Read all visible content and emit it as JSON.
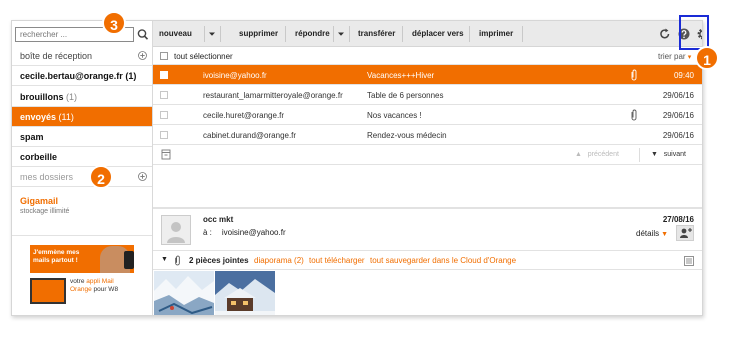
{
  "search": {
    "placeholder": "rechercher ..."
  },
  "sidebar": {
    "items": [
      {
        "label": "boîte de réception",
        "count": ""
      },
      {
        "label": "cecile.bertau@orange.fr",
        "count": "(1)"
      },
      {
        "label": "brouillons",
        "count": "(1)"
      },
      {
        "label": "envoyés",
        "count": "(11)"
      },
      {
        "label": "spam",
        "count": ""
      },
      {
        "label": "corbeille",
        "count": ""
      },
      {
        "label": "mes dossiers",
        "count": ""
      }
    ],
    "gigamail": {
      "title": "Gigamail",
      "subtitle": "stockage illimité"
    },
    "promo": {
      "top_text": "J'emmène mes mails partout !",
      "bottom_prefix": "votre ",
      "bottom_highlight": "appli Mail Orange",
      "bottom_suffix": " pour W8"
    }
  },
  "toolbar": {
    "new_label": "nouveau",
    "delete_label": "supprimer",
    "reply_label": "répondre",
    "forward_label": "transférer",
    "move_label": "déplacer vers",
    "print_label": "imprimer"
  },
  "list": {
    "select_all_label": "tout sélectionner",
    "sort_label": "trier par",
    "rows": [
      {
        "from": "ivoisine@yahoo.fr",
        "subject": "Vacances+++Hiver",
        "date": "09:40",
        "attachment": true,
        "selected": true
      },
      {
        "from": "restaurant_lamarmitteroyale@orange.fr",
        "subject": "Table de 6 personnes",
        "date": "29/06/16",
        "attachment": false,
        "selected": false
      },
      {
        "from": "cecile.huret@orange.fr",
        "subject": "Nos vacances !",
        "date": "29/06/16",
        "attachment": true,
        "selected": false
      },
      {
        "from": "cabinet.durand@orange.fr",
        "subject": "Rendez-vous médecin",
        "date": "29/06/16",
        "attachment": false,
        "selected": false
      }
    ],
    "prev_label": "précédent",
    "next_label": "suivant"
  },
  "reader": {
    "from": "occ mkt",
    "to_label": "à :",
    "to": "ivoisine@yahoo.fr",
    "date": "27/08/16",
    "details_label": "détails",
    "attachments_count": "2 pièces jointes",
    "links": [
      "diaporama (2)",
      "tout télécharger",
      "tout sauvegarder dans le Cloud d'Orange"
    ]
  },
  "annotations": {
    "one": "1",
    "two": "2",
    "three": "3"
  },
  "colors": {
    "accent": "#f16e00",
    "highlight_box": "#1a2bd6"
  },
  "icons": [
    "search-icon",
    "plus-icon",
    "chevron-down-icon",
    "refresh-icon",
    "help-icon",
    "gear-icon",
    "paperclip-icon",
    "checkbox-icon",
    "arrow-up-icon",
    "arrow-down-icon",
    "add-contact-icon",
    "list-view-icon",
    "avatar-icon",
    "archive-icon"
  ]
}
